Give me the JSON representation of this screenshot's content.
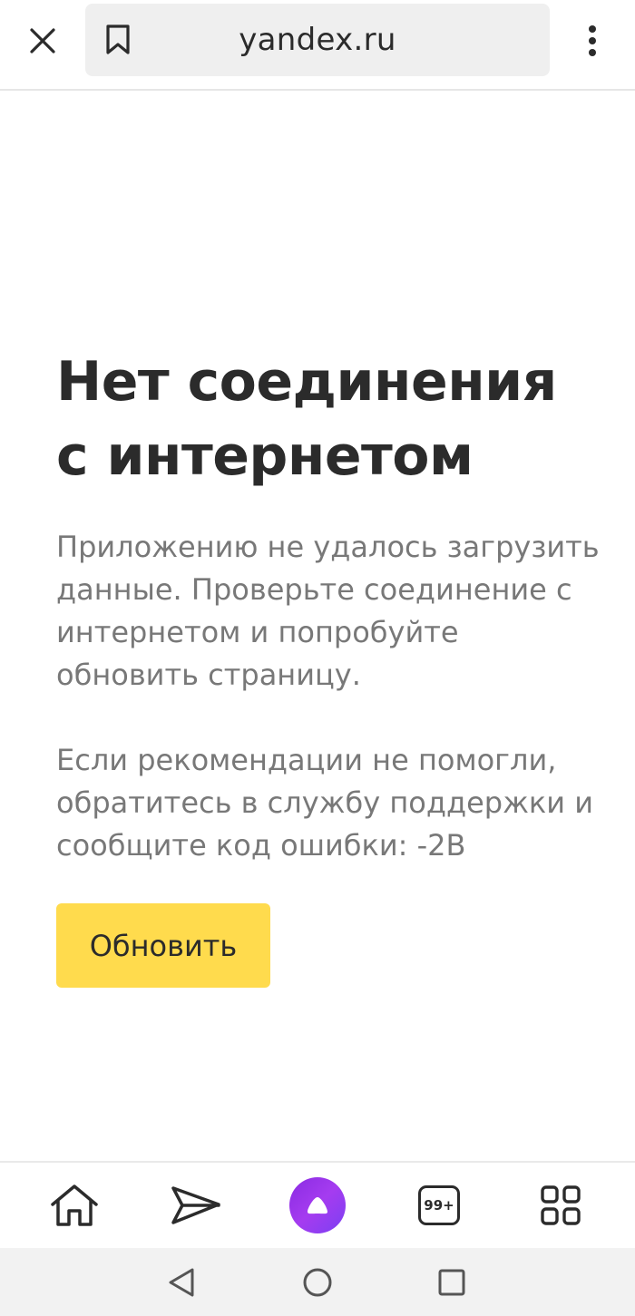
{
  "browser": {
    "url": "yandex.ru",
    "icons": {
      "close": "close-icon",
      "bookmark": "bookmark-icon",
      "menu": "more-vertical-icon"
    }
  },
  "error_page": {
    "title": "Нет соединения с интернетом",
    "description": "Приложению не удалось загрузить данные. Проверьте соединение с интернетом и попробуйте обновить страницу.",
    "support_text": "Если рекомендации не помогли, обратитесь в службу поддержки и сообщите код ошибки: -2B",
    "refresh_label": "Обновить",
    "button_color": "#ffdb4d"
  },
  "toolbar": {
    "items": [
      {
        "name": "home",
        "icon": "home-icon"
      },
      {
        "name": "messenger",
        "icon": "send-icon"
      },
      {
        "name": "alice",
        "icon": "alice-icon"
      },
      {
        "name": "tabs",
        "icon": "tabs-icon",
        "count": "99+"
      },
      {
        "name": "services",
        "icon": "grid-icon"
      }
    ]
  },
  "system_nav": {
    "icons": [
      "back-icon",
      "home-circle-icon",
      "recents-icon"
    ]
  }
}
